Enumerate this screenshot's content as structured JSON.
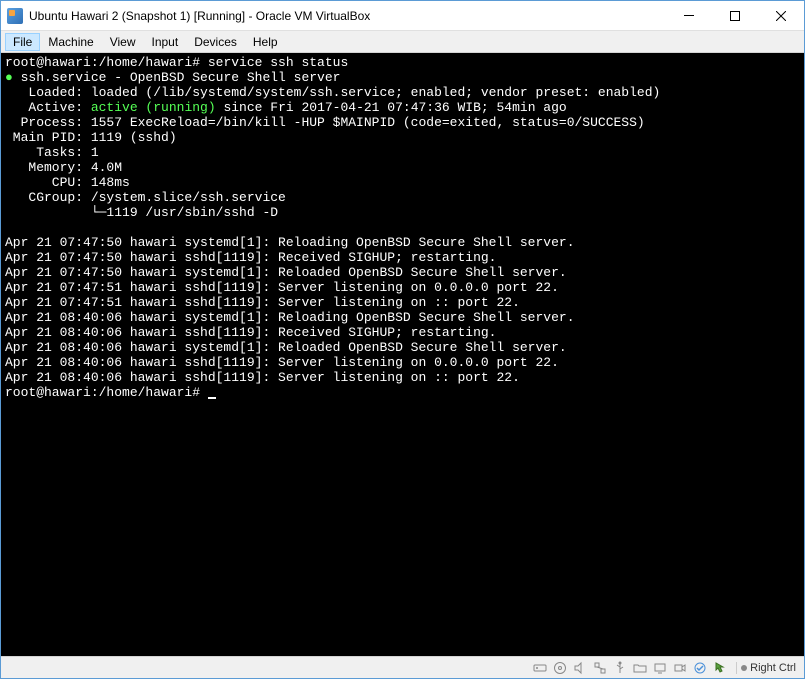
{
  "window": {
    "title": "Ubuntu Hawari 2 (Snapshot 1) [Running] - Oracle VM VirtualBox"
  },
  "menubar": {
    "items": [
      "File",
      "Machine",
      "View",
      "Input",
      "Devices",
      "Help"
    ],
    "active_index": 0
  },
  "terminal": {
    "prompt1": "root@hawari:/home/hawari# ",
    "command1": "service ssh status",
    "bullet": "●",
    "service_line": " ssh.service - OpenBSD Secure Shell server",
    "loaded": "   Loaded: loaded (/lib/systemd/system/ssh.service; enabled; vendor preset: enabled)",
    "active_label": "   Active: ",
    "active_value": "active (running)",
    "active_rest": " since Fri 2017-04-21 07:47:36 WIB; 54min ago",
    "process": "  Process: 1557 ExecReload=/bin/kill -HUP $MAINPID (code=exited, status=0/SUCCESS)",
    "mainpid": " Main PID: 1119 (sshd)",
    "tasks": "    Tasks: 1",
    "memory": "   Memory: 4.0M",
    "cpu": "      CPU: 148ms",
    "cgroup1": "   CGroup: /system.slice/ssh.service",
    "cgroup2": "           └─1119 /usr/sbin/sshd -D",
    "blank": "",
    "log1": "Apr 21 07:47:50 hawari systemd[1]: Reloading OpenBSD Secure Shell server.",
    "log2": "Apr 21 07:47:50 hawari sshd[1119]: Received SIGHUP; restarting.",
    "log3": "Apr 21 07:47:50 hawari systemd[1]: Reloaded OpenBSD Secure Shell server.",
    "log4": "Apr 21 07:47:51 hawari sshd[1119]: Server listening on 0.0.0.0 port 22.",
    "log5": "Apr 21 07:47:51 hawari sshd[1119]: Server listening on :: port 22.",
    "log6": "Apr 21 08:40:06 hawari systemd[1]: Reloading OpenBSD Secure Shell server.",
    "log7": "Apr 21 08:40:06 hawari sshd[1119]: Received SIGHUP; restarting.",
    "log8": "Apr 21 08:40:06 hawari systemd[1]: Reloaded OpenBSD Secure Shell server.",
    "log9": "Apr 21 08:40:06 hawari sshd[1119]: Server listening on 0.0.0.0 port 22.",
    "log10": "Apr 21 08:40:06 hawari sshd[1119]: Server listening on :: port 22.",
    "prompt2": "root@hawari:/home/hawari# "
  },
  "statusbar": {
    "host_key": "Right Ctrl"
  }
}
